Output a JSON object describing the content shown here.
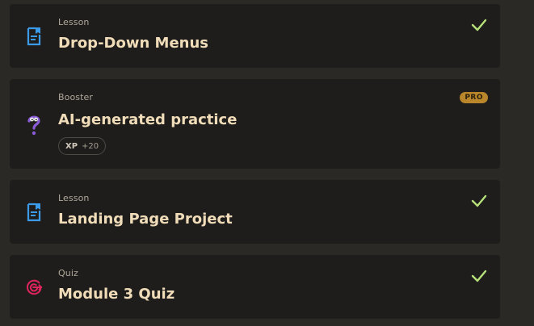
{
  "items": [
    {
      "kind": "Lesson",
      "title": "Drop-Down Menus",
      "icon": "lesson-document-icon",
      "completed": true
    },
    {
      "kind": "Booster",
      "title": "AI-generated practice",
      "icon": "question-mark-icon",
      "badge": "PRO",
      "xp_label": "XP",
      "xp_value": "+20"
    },
    {
      "kind": "Lesson",
      "title": "Landing Page Project",
      "icon": "lesson-document-icon",
      "completed": true
    },
    {
      "kind": "Quiz",
      "title": "Module 3 Quiz",
      "icon": "target-icon",
      "completed": true
    }
  ],
  "colors": {
    "background": "#2a2926",
    "card": "#1e1d1b",
    "lesson_icon": "#3b9be8",
    "booster_icon": "#8a5bd6",
    "quiz_icon": "#e0245e",
    "check": "#b6e07a",
    "pro_badge": "#b9862c",
    "title": "#f0dcb8"
  }
}
